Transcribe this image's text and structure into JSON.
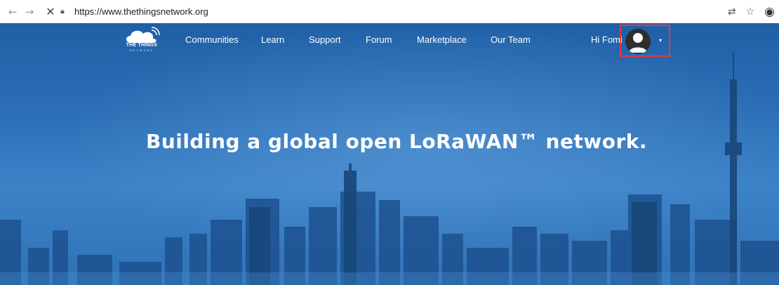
{
  "browser": {
    "url": "https://www.thethingsnetwork.org",
    "back_icon": "arrow-left-icon",
    "forward_icon": "arrow-right-icon",
    "stop_icon": "close-icon",
    "lock_icon": "lock-icon",
    "translate_icon": "translate-icon",
    "bookmark_icon": "star-icon",
    "account_icon": "account-icon"
  },
  "site": {
    "logo": {
      "line1": "THE THINGS",
      "line2": "NETWORK"
    },
    "nav": [
      {
        "label": "Communities"
      },
      {
        "label": "Learn"
      },
      {
        "label": "Support"
      },
      {
        "label": "Forum"
      },
      {
        "label": "Marketplace"
      },
      {
        "label": "Our Team"
      }
    ],
    "greeting": "Hi Fomi",
    "caret": "▾",
    "headline": "Building a global open LoRaWAN™ network."
  },
  "colors": {
    "hero_top": "#1f5fa6",
    "hero_mid": "#3c82c7",
    "highlight_box": "#e23b3b",
    "building": "#1d5190"
  }
}
